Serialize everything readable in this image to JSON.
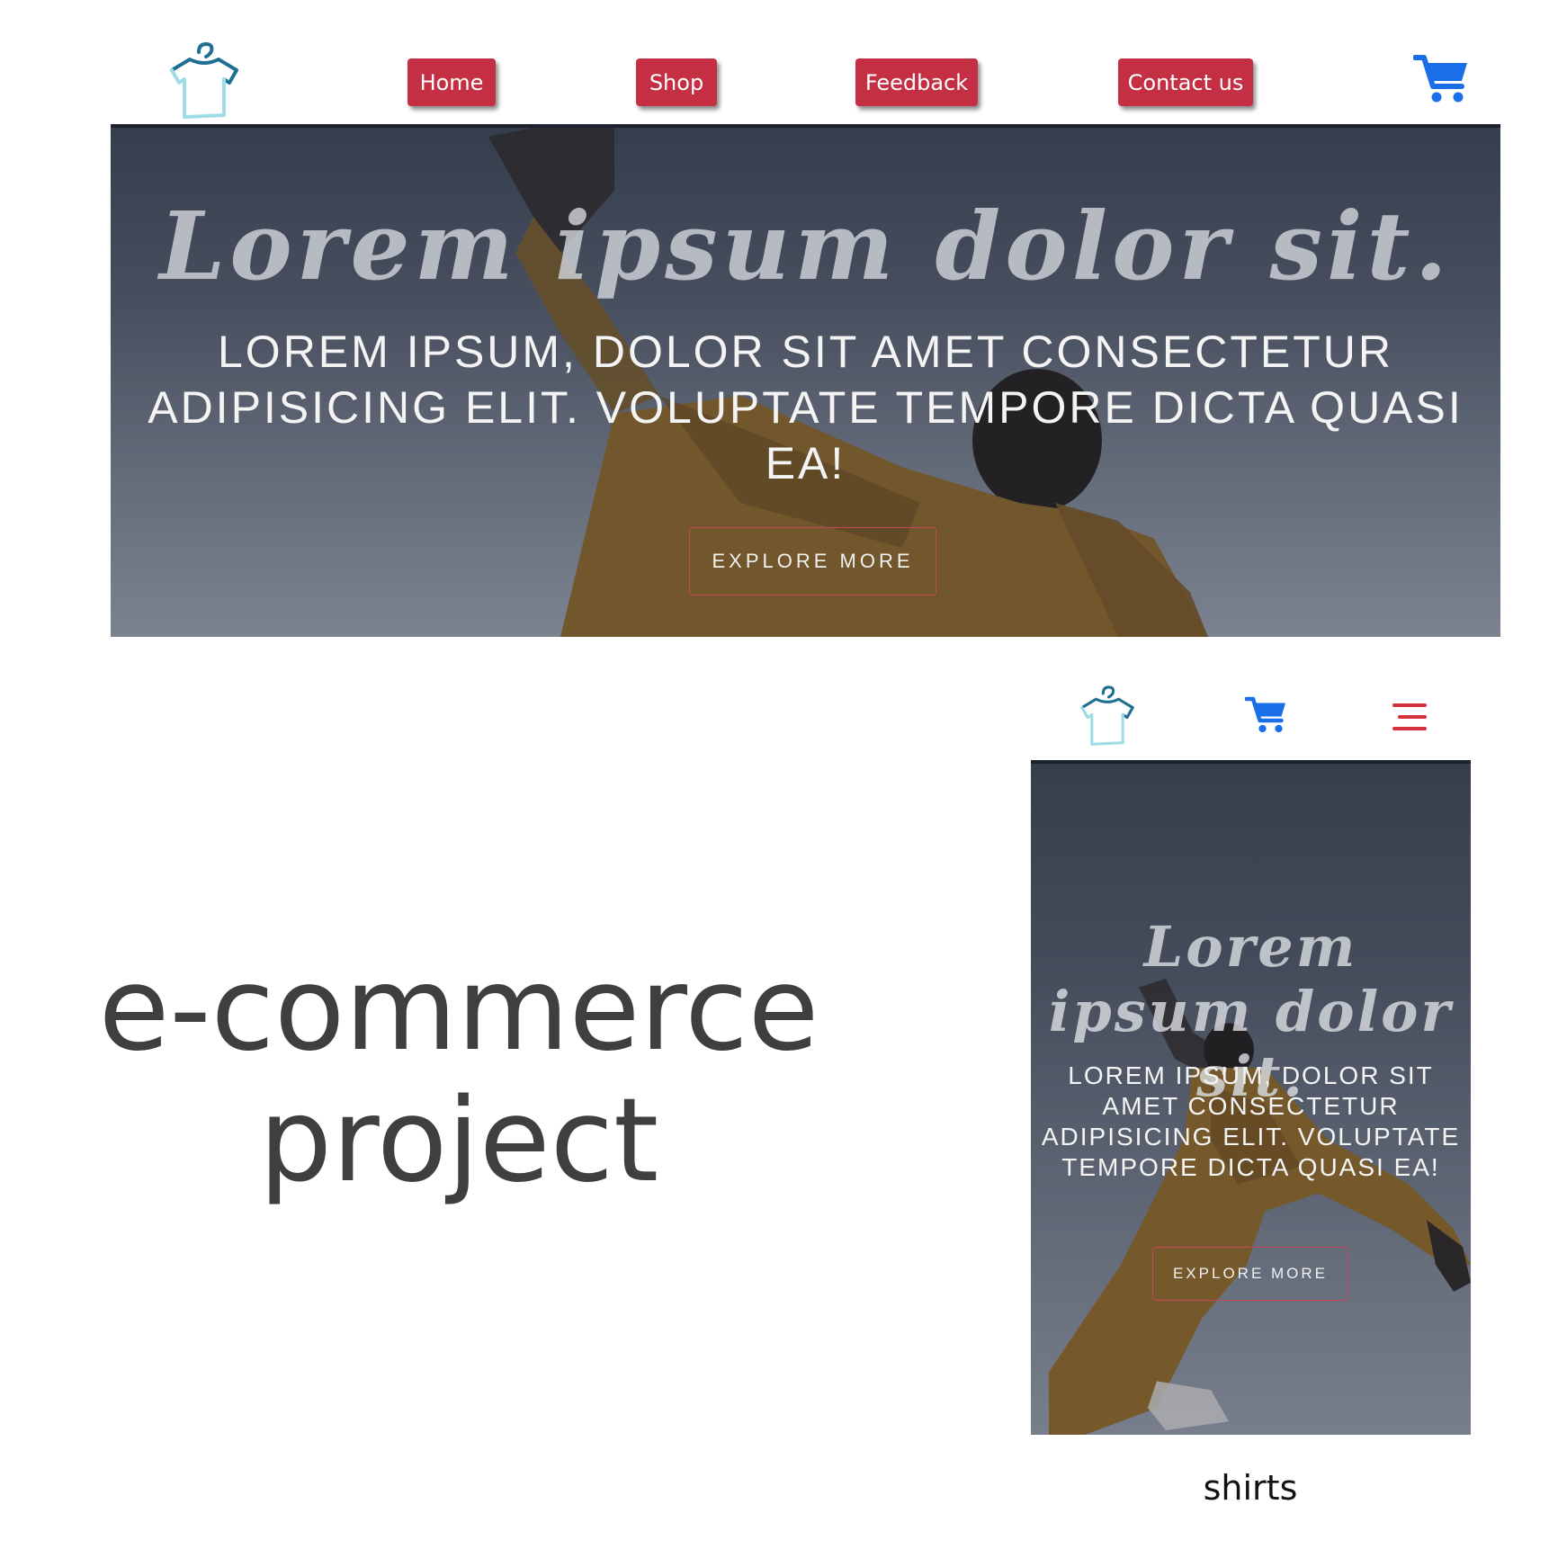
{
  "desktop": {
    "nav": [
      {
        "label": "Home"
      },
      {
        "label": "Shop"
      },
      {
        "label": "Feedback"
      },
      {
        "label": "Contact us"
      }
    ],
    "hero": {
      "title": "Lorem ipsum dolor sit.",
      "subtitle": "LOREM IPSUM, DOLOR SIT AMET CONSECTETUR ADIPISICING ELIT. VOLUPTATE TEMPORE DICTA QUASI EA!",
      "cta": "EXPLORE MORE"
    }
  },
  "project_label": {
    "line1": "e-commerce",
    "line2": "project"
  },
  "mobile": {
    "hero": {
      "title": "Lorem ipsum dolor sit.",
      "subtitle": "LOREM IPSUM, DOLOR SIT AMET CONSECTETUR ADIPISICING ELIT. VOLUPTATE TEMPORE DICTA QUASI EA!",
      "cta": "EXPLORE MORE"
    },
    "caption": "shirts"
  },
  "icons": {
    "logo": "shirt-hanger-icon",
    "cart": "shopping-cart-icon",
    "menu": "hamburger-menu-icon"
  },
  "colors": {
    "nav_button": "#c42f43",
    "cart": "#1a6ee8",
    "menu": "#d6303f",
    "cta_border": "#c4485a",
    "logo_stroke_dark": "#1f6f93",
    "logo_stroke_light": "#9fdde6"
  }
}
